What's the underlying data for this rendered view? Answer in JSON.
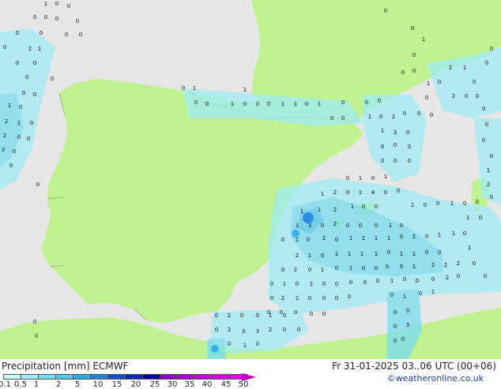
{
  "footer": {
    "title": "Precipitation [mm]  ECMWF",
    "valid": "Fr 31-01-2025 03..06 UTC (00+06)",
    "credit": "©weatheronline.co.uk"
  },
  "colorbar": {
    "labels": [
      "0.1",
      "0.5",
      "1",
      "2",
      "5",
      "10",
      "15",
      "20",
      "25",
      "30",
      "35",
      "40",
      "45",
      "50"
    ],
    "colors": [
      "#c8f5f5",
      "#a0ebf5",
      "#78dcf0",
      "#50c8eb",
      "#28aae6",
      "#1e82dc",
      "#1450c8",
      "#0a28b4",
      "#0000a0",
      "#8c00c8",
      "#aa00d2",
      "#c800dc",
      "#dc00e6",
      "#f000f0"
    ]
  },
  "map": {
    "land_color": "#bff28f",
    "sea_color": "#e8e8e8",
    "labels": [
      [
        "1",
        58,
        7
      ],
      [
        "0",
        72,
        7
      ],
      [
        "0",
        87,
        10
      ],
      [
        "0",
        44,
        24
      ],
      [
        "0",
        58,
        24
      ],
      [
        "0",
        72,
        26
      ],
      [
        "0",
        98,
        29
      ],
      [
        "0",
        22,
        44
      ],
      [
        "0",
        52,
        44
      ],
      [
        "0",
        84,
        46
      ],
      [
        "0",
        102,
        46
      ],
      [
        "0",
        6,
        62
      ],
      [
        "2",
        38,
        64
      ],
      [
        "1",
        50,
        64
      ],
      [
        "0",
        22,
        82
      ],
      [
        "0",
        44,
        82
      ],
      [
        "0",
        34,
        100
      ],
      [
        "0",
        66,
        102
      ],
      [
        "0",
        30,
        120
      ],
      [
        "0",
        44,
        122
      ],
      [
        "1",
        12,
        136
      ],
      [
        "0",
        26,
        138
      ],
      [
        "2",
        8,
        156
      ],
      [
        "1",
        24,
        158
      ],
      [
        "0",
        40,
        158
      ],
      [
        "2",
        6,
        174
      ],
      [
        "0",
        24,
        176
      ],
      [
        "0",
        36,
        178
      ],
      [
        "3",
        4,
        192
      ],
      [
        "0",
        18,
        194
      ],
      [
        "0",
        14,
        212
      ],
      [
        "0",
        48,
        236
      ],
      [
        "0",
        232,
        114
      ],
      [
        "1",
        246,
        114
      ],
      [
        "1",
        310,
        116
      ],
      [
        "0",
        248,
        132
      ],
      [
        "0",
        262,
        134
      ],
      [
        "1",
        294,
        134
      ],
      [
        "0",
        310,
        134
      ],
      [
        "0",
        326,
        134
      ],
      [
        "0",
        340,
        134
      ],
      [
        "1",
        358,
        134
      ],
      [
        "1",
        374,
        134
      ],
      [
        "0",
        388,
        134
      ],
      [
        "1",
        404,
        134
      ],
      [
        "0",
        434,
        132
      ],
      [
        "0",
        420,
        152
      ],
      [
        "0",
        434,
        152
      ],
      [
        "0",
        488,
        16
      ],
      [
        "0",
        522,
        38
      ],
      [
        "1",
        536,
        52
      ],
      [
        "0",
        524,
        72
      ],
      [
        "0",
        510,
        94
      ],
      [
        "0",
        524,
        92
      ],
      [
        "1",
        542,
        108
      ],
      [
        "0",
        556,
        106
      ],
      [
        "0",
        540,
        126
      ],
      [
        "2",
        570,
        88
      ],
      [
        "1",
        588,
        88
      ],
      [
        "0",
        600,
        106
      ],
      [
        "2",
        574,
        124
      ],
      [
        "0",
        590,
        124
      ],
      [
        "0",
        604,
        124
      ],
      [
        "0",
        616,
        82
      ],
      [
        "0",
        622,
        64
      ],
      [
        "0",
        612,
        140
      ],
      [
        "0",
        616,
        160
      ],
      [
        "0",
        612,
        180
      ],
      [
        "0",
        622,
        200
      ],
      [
        "1",
        618,
        218
      ],
      [
        "2",
        618,
        236
      ],
      [
        "0",
        622,
        252
      ],
      [
        "0",
        464,
        132
      ],
      [
        "0",
        480,
        130
      ],
      [
        "1",
        468,
        150
      ],
      [
        "0",
        482,
        150
      ],
      [
        "2",
        498,
        150
      ],
      [
        "0",
        512,
        146
      ],
      [
        "0",
        530,
        146
      ],
      [
        "0",
        546,
        148
      ],
      [
        "1",
        484,
        168
      ],
      [
        "3",
        500,
        170
      ],
      [
        "0",
        516,
        170
      ],
      [
        "0",
        484,
        188
      ],
      [
        "0",
        500,
        186
      ],
      [
        "0",
        518,
        188
      ],
      [
        "0",
        484,
        206
      ],
      [
        "0",
        500,
        206
      ],
      [
        "0",
        518,
        206
      ],
      [
        "0",
        440,
        228
      ],
      [
        "1",
        456,
        228
      ],
      [
        "0",
        472,
        228
      ],
      [
        "1",
        488,
        226
      ],
      [
        "0",
        504,
        244
      ],
      [
        "1",
        408,
        248
      ],
      [
        "2",
        424,
        246
      ],
      [
        "0",
        440,
        246
      ],
      [
        "1",
        456,
        246
      ],
      [
        "4",
        472,
        246
      ],
      [
        "0",
        488,
        246
      ],
      [
        "1",
        404,
        268
      ],
      [
        "2",
        424,
        268
      ],
      [
        "1",
        446,
        264
      ],
      [
        "0",
        460,
        264
      ],
      [
        "0",
        476,
        264
      ],
      [
        "1",
        382,
        270
      ],
      [
        "1",
        376,
        288
      ],
      [
        "3",
        392,
        288
      ],
      [
        "0",
        408,
        288
      ],
      [
        "2",
        424,
        286
      ],
      [
        "0",
        440,
        288
      ],
      [
        "0",
        456,
        288
      ],
      [
        "0",
        476,
        288
      ],
      [
        "1",
        494,
        288
      ],
      [
        "0",
        508,
        288
      ],
      [
        "1",
        522,
        262
      ],
      [
        "0",
        538,
        262
      ],
      [
        "0",
        554,
        260
      ],
      [
        "1",
        572,
        260
      ],
      [
        "0",
        588,
        260
      ],
      [
        "0",
        604,
        258
      ],
      [
        "1",
        592,
        278
      ],
      [
        "0",
        608,
        278
      ],
      [
        "0",
        358,
        306
      ],
      [
        "1",
        376,
        306
      ],
      [
        "0",
        390,
        306
      ],
      [
        "2",
        410,
        304
      ],
      [
        "0",
        426,
        306
      ],
      [
        "1",
        444,
        304
      ],
      [
        "2",
        460,
        304
      ],
      [
        "1",
        476,
        304
      ],
      [
        "1",
        492,
        304
      ],
      [
        "0",
        508,
        302
      ],
      [
        "2",
        524,
        302
      ],
      [
        "0",
        540,
        302
      ],
      [
        "1",
        556,
        300
      ],
      [
        "1",
        574,
        298
      ],
      [
        "0",
        588,
        298
      ],
      [
        "1",
        594,
        316
      ],
      [
        "2",
        376,
        326
      ],
      [
        "1",
        392,
        326
      ],
      [
        "0",
        408,
        326
      ],
      [
        "1",
        426,
        324
      ],
      [
        "1",
        442,
        324
      ],
      [
        "1",
        458,
        324
      ],
      [
        "1",
        476,
        324
      ],
      [
        "0",
        492,
        322
      ],
      [
        "1",
        508,
        324
      ],
      [
        "1",
        524,
        324
      ],
      [
        "0",
        540,
        322
      ],
      [
        "0",
        556,
        322
      ],
      [
        "0",
        358,
        344
      ],
      [
        "2",
        374,
        344
      ],
      [
        "0",
        392,
        344
      ],
      [
        "1",
        408,
        344
      ],
      [
        "0",
        426,
        342
      ],
      [
        "1",
        444,
        342
      ],
      [
        "0",
        460,
        342
      ],
      [
        "0",
        476,
        342
      ],
      [
        "0",
        490,
        340
      ],
      [
        "0",
        508,
        340
      ],
      [
        "1",
        524,
        340
      ],
      [
        "2",
        548,
        338
      ],
      [
        "2",
        564,
        338
      ],
      [
        "2",
        580,
        336
      ],
      [
        "0",
        600,
        336
      ],
      [
        "0",
        344,
        362
      ],
      [
        "1",
        360,
        362
      ],
      [
        "0",
        376,
        362
      ],
      [
        "1",
        394,
        362
      ],
      [
        "0",
        410,
        362
      ],
      [
        "0",
        426,
        362
      ],
      [
        "0",
        444,
        360
      ],
      [
        "0",
        462,
        360
      ],
      [
        "0",
        478,
        358
      ],
      [
        "1",
        496,
        358
      ],
      [
        "0",
        512,
        356
      ],
      [
        "0",
        528,
        358
      ],
      [
        "0",
        548,
        356
      ],
      [
        "2",
        566,
        354
      ],
      [
        "0",
        580,
        352
      ],
      [
        "0",
        614,
        352
      ],
      [
        "0",
        344,
        380
      ],
      [
        "2",
        358,
        380
      ],
      [
        "1",
        376,
        380
      ],
      [
        "0",
        392,
        380
      ],
      [
        "0",
        410,
        380
      ],
      [
        "0",
        426,
        380
      ],
      [
        "0",
        442,
        378
      ],
      [
        "0",
        496,
        376
      ],
      [
        "1",
        512,
        378
      ],
      [
        "0",
        532,
        374
      ],
      [
        "1",
        548,
        372
      ],
      [
        "0",
        340,
        398
      ],
      [
        "0",
        356,
        398
      ],
      [
        "0",
        374,
        398
      ],
      [
        "0",
        500,
        398
      ],
      [
        "0",
        516,
        396
      ],
      [
        "0",
        274,
        402
      ],
      [
        "2",
        290,
        402
      ],
      [
        "0",
        306,
        402
      ],
      [
        "0",
        326,
        402
      ],
      [
        "1",
        342,
        402
      ],
      [
        "0",
        360,
        402
      ],
      [
        "0",
        394,
        400
      ],
      [
        "0",
        410,
        400
      ],
      [
        "0",
        274,
        420
      ],
      [
        "2",
        290,
        420
      ],
      [
        "3",
        308,
        422
      ],
      [
        "3",
        326,
        422
      ],
      [
        "2",
        342,
        420
      ],
      [
        "0",
        360,
        420
      ],
      [
        "0",
        378,
        420
      ],
      [
        "0",
        500,
        416
      ],
      [
        "3",
        516,
        414
      ],
      [
        "0",
        510,
        432
      ],
      [
        "0",
        290,
        438
      ],
      [
        "1",
        310,
        440
      ],
      [
        "0",
        326,
        438
      ],
      [
        "0",
        500,
        434
      ],
      [
        "0",
        44,
        410
      ],
      [
        "0",
        46,
        428
      ]
    ]
  }
}
